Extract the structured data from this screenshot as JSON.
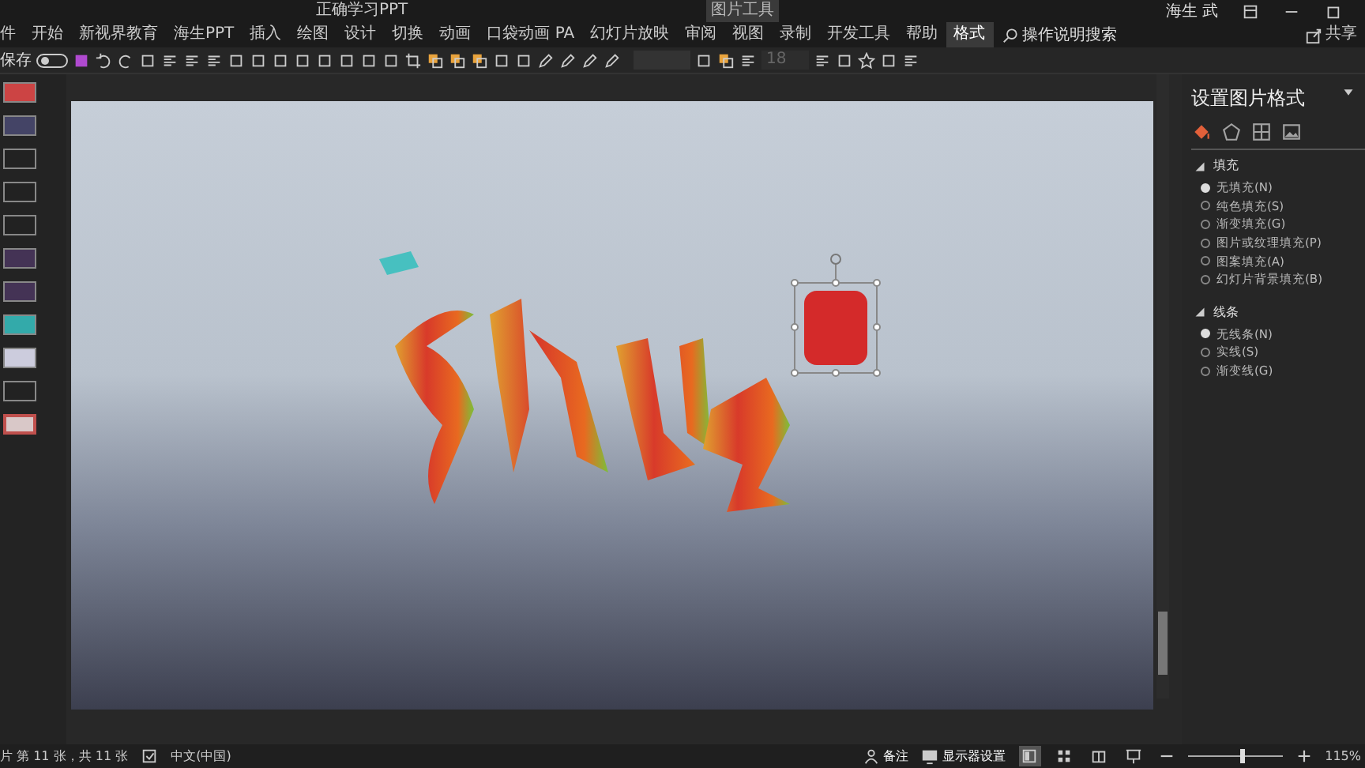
{
  "window": {
    "title": "正确学习PPT",
    "context_label": "图片工具",
    "user": "海生 武"
  },
  "ribbon_tabs": [
    {
      "label": "件",
      "selected": false
    },
    {
      "label": "开始",
      "selected": false
    },
    {
      "label": "新视界教育",
      "selected": false
    },
    {
      "label": "海生PPT",
      "selected": false
    },
    {
      "label": "插入",
      "selected": false
    },
    {
      "label": "绘图",
      "selected": false
    },
    {
      "label": "设计",
      "selected": false
    },
    {
      "label": "切换",
      "selected": false
    },
    {
      "label": "动画",
      "selected": false
    },
    {
      "label": "口袋动画 PA",
      "selected": false
    },
    {
      "label": "幻灯片放映",
      "selected": false
    },
    {
      "label": "审阅",
      "selected": false
    },
    {
      "label": "视图",
      "selected": false
    },
    {
      "label": "录制",
      "selected": false
    },
    {
      "label": "开发工具",
      "selected": false
    },
    {
      "label": "帮助",
      "selected": false
    },
    {
      "label": "格式",
      "selected": true
    }
  ],
  "search": {
    "placeholder": "操作说明搜索"
  },
  "share": "共享",
  "toolbar": {
    "autosave": {
      "label": "保存",
      "on": false
    },
    "font_size": "18"
  },
  "thumbnails": [
    {
      "selected": false
    },
    {
      "selected": false
    },
    {
      "selected": false
    },
    {
      "selected": false
    },
    {
      "selected": false
    },
    {
      "selected": false
    },
    {
      "selected": false
    },
    {
      "selected": false
    },
    {
      "selected": false
    },
    {
      "selected": false
    },
    {
      "selected": true
    }
  ],
  "format_pane": {
    "title": "设置图片格式",
    "tabs": [
      {
        "kind": "fill",
        "selected": true
      },
      {
        "kind": "shape",
        "selected": false
      },
      {
        "kind": "size",
        "selected": false
      },
      {
        "kind": "picture",
        "selected": false
      }
    ],
    "sections": [
      {
        "title": "填充",
        "expanded": true,
        "options": [
          {
            "label": "无填充(N)",
            "selected": true
          },
          {
            "label": "纯色填充(S)",
            "selected": false
          },
          {
            "label": "渐变填充(G)",
            "selected": false
          },
          {
            "label": "图片或纹理填充(P)",
            "selected": false
          },
          {
            "label": "图案填充(A)",
            "selected": false
          },
          {
            "label": "幻灯片背景填充(B)",
            "selected": false
          }
        ]
      },
      {
        "title": "线条",
        "expanded": true,
        "options": [
          {
            "label": "无线条(N)",
            "selected": true
          },
          {
            "label": "实线(S)",
            "selected": false
          },
          {
            "label": "渐变线(G)",
            "selected": false
          }
        ]
      }
    ]
  },
  "status_bar": {
    "slide_info": "片 第 11 张，共 11 张",
    "language": "中文(中国)",
    "notes": "备注",
    "display_settings": "显示器设置",
    "views": [
      {
        "kind": "normal",
        "selected": true
      },
      {
        "kind": "sorter",
        "selected": false
      },
      {
        "kind": "reading",
        "selected": false
      },
      {
        "kind": "show",
        "selected": false
      }
    ],
    "zoom": {
      "level": 0.55,
      "reading": "115%"
    }
  }
}
